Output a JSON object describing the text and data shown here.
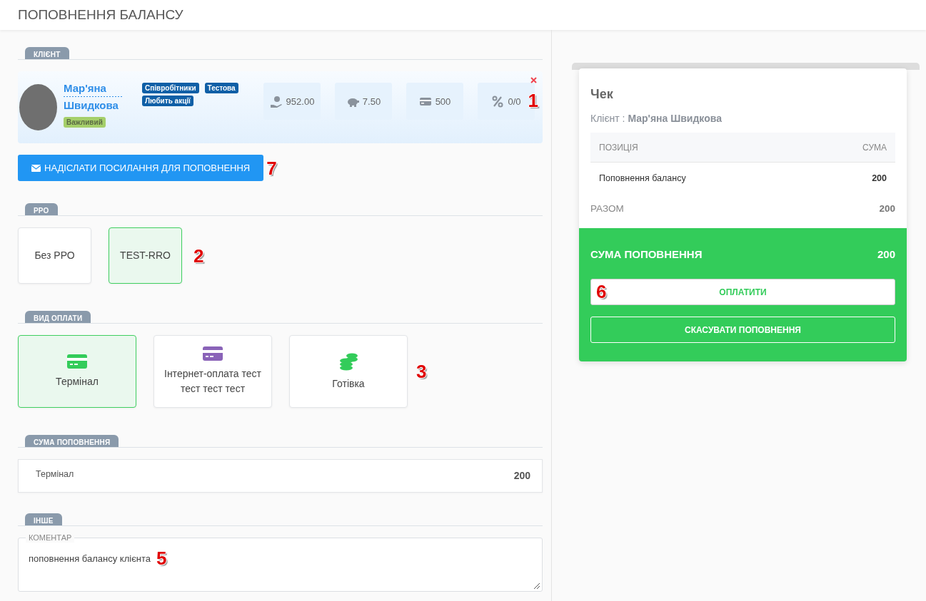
{
  "page": {
    "title": "ПОПОВНЕННЯ БАЛАНСУ"
  },
  "client_section": {
    "heading": "КЛІЄНТ",
    "client": {
      "name": "Мар'яна Швидкова",
      "label": "Важливий",
      "tags": [
        "Співробітники",
        "Тестова",
        "Любить акції"
      ],
      "stats": [
        {
          "kind": "bonus",
          "value": "952.00"
        },
        {
          "kind": "piggy",
          "value": "7.50"
        },
        {
          "kind": "card",
          "value": "500"
        },
        {
          "kind": "percent",
          "value": "0/0"
        }
      ],
      "callout": "1"
    },
    "send_button": {
      "label": "НАДІСЛАТИ ПОСИЛАННЯ ДЛЯ ПОПОВНЕННЯ",
      "callout": "7"
    }
  },
  "fiscal_section": {
    "heading": "РРО",
    "options": [
      {
        "label": "Без РРО",
        "selected": false
      },
      {
        "label": "TEST-RRO",
        "selected": true
      }
    ],
    "callout": "2"
  },
  "payment_section": {
    "heading": "ВИД ОПЛАТИ",
    "options": [
      {
        "label": "Термінал",
        "kind": "card",
        "color": "#33cc5a",
        "selected": true
      },
      {
        "label": "Інтернет-оплата тест тест тест тест",
        "kind": "card",
        "color": "#8a63b8",
        "selected": false
      },
      {
        "label": "Готівка",
        "kind": "coins",
        "color": "#33cc5a",
        "selected": false
      }
    ],
    "callout": "3"
  },
  "amount_section": {
    "heading": "СУМА ПОПОВНЕННЯ",
    "rows": [
      {
        "method": "Термінал",
        "amount": "200"
      }
    ]
  },
  "other_section": {
    "heading": "ІНШЕ",
    "comment": {
      "label": "КОМЕНТАР",
      "value": "поповнення балансу клієнта",
      "callout": "5"
    }
  },
  "receipt": {
    "title": "Чек",
    "client_line": "Клієнт : **Мар'яна Швидкова**",
    "columns": [
      "ПОЗИЦІЯ",
      "СУМА"
    ],
    "rows": [
      {
        "item": "Поповнення балансу",
        "amount": "200"
      }
    ],
    "total_label": "РАЗОМ",
    "total": "200",
    "topup_label": "СУМА ПОПОВНЕННЯ",
    "topup_amount": "200",
    "pay_button": {
      "label": "ОПЛАТИТИ",
      "callout": "6"
    },
    "cancel_button": {
      "label": "СКАСУВАТИ ПОПОВНЕННЯ"
    }
  }
}
